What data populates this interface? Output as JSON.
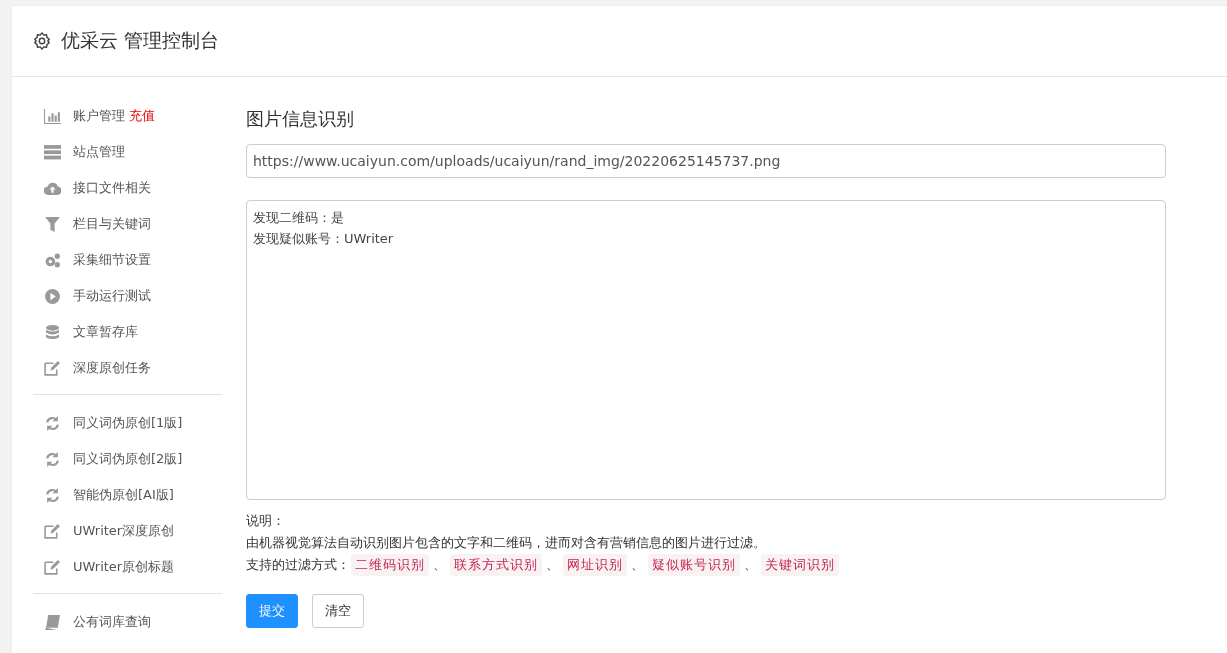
{
  "header": {
    "title": "优采云 管理控制台"
  },
  "sidebar": {
    "groups": [
      {
        "items": [
          {
            "label": "账户管理",
            "badge": "充值"
          },
          {
            "label": "站点管理"
          },
          {
            "label": "接口文件相关"
          },
          {
            "label": "栏目与关键词"
          },
          {
            "label": "采集细节设置"
          },
          {
            "label": "手动运行测试"
          },
          {
            "label": "文章暂存库"
          },
          {
            "label": "深度原创任务"
          }
        ]
      },
      {
        "items": [
          {
            "label": "同义词伪原创[1版]"
          },
          {
            "label": "同义词伪原创[2版]"
          },
          {
            "label": "智能伪原创[AI版]"
          },
          {
            "label": "UWriter深度原创"
          },
          {
            "label": "UWriter原创标题"
          }
        ]
      },
      {
        "items": [
          {
            "label": "公有词库查询"
          }
        ]
      }
    ]
  },
  "main": {
    "title": "图片信息识别",
    "url_field": {
      "value": "https://www.ucaiyun.com/uploads/ucaiyun/rand_img/20220625145737.png"
    },
    "result_box": {
      "lines": [
        "发现二维码：是",
        "发现疑似账号：UWriter"
      ]
    },
    "notes": {
      "heading": "说明：",
      "description": "由机器视觉算法自动识别图片包含的文字和二维码，进而对含有营销信息的图片进行过滤。",
      "filter_label": "支持的过滤方式：",
      "separator": "、",
      "tags": [
        "二维码识别",
        "联系方式识别",
        "网址识别",
        "疑似账号识别",
        "关键词识别"
      ]
    },
    "buttons": [
      {
        "label": "提交",
        "kind": "primary"
      },
      {
        "label": "清空",
        "kind": "default"
      }
    ]
  }
}
